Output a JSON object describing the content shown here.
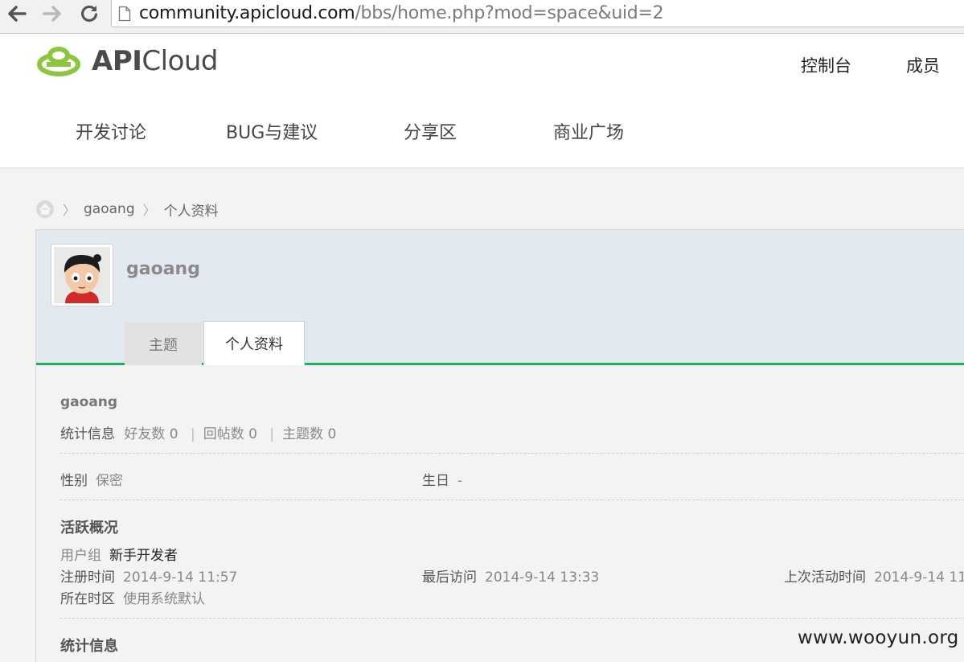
{
  "browser": {
    "url_host": "community.apicloud.com",
    "url_path": "/bbs/home.php?mod=space&uid=2"
  },
  "header": {
    "logo_bold": "API",
    "logo_light": "Cloud",
    "top_links": [
      "控制台",
      "成员"
    ],
    "nav": [
      "开发讨论",
      "BUG与建议",
      "分享区",
      "商业广场"
    ]
  },
  "breadcrumb": {
    "user": "gaoang",
    "page": "个人资料"
  },
  "profile": {
    "username": "gaoang",
    "tabs": {
      "topics": "主题",
      "profile": "个人资料"
    }
  },
  "summary": {
    "username": "gaoang",
    "stats_label": "统计信息",
    "friends": "好友数 0",
    "replies": "回帖数 0",
    "topics": "主题数 0",
    "pipe": "|"
  },
  "basic": {
    "gender_label": "性别",
    "gender_value": "保密",
    "birthday_label": "生日",
    "birthday_value": "-"
  },
  "activity": {
    "title": "活跃概况",
    "group_label": "用户组",
    "group_value": "新手开发者",
    "reg_label": "注册时间",
    "reg_value": "2014-9-14 11:57",
    "last_visit_label": "最后访问",
    "last_visit_value": "2014-9-14 13:33",
    "last_active_label": "上次活动时间",
    "last_active_value": "2014-9-14 11:",
    "tz_label": "所在时区",
    "tz_value": "使用系统默认"
  },
  "stats_section_title": "统计信息",
  "watermark": "www.wooyun.org",
  "colors": {
    "accent_green": "#21b05f",
    "logo_green": "#8cc63f",
    "panel_blue": "#e3e9f1"
  }
}
